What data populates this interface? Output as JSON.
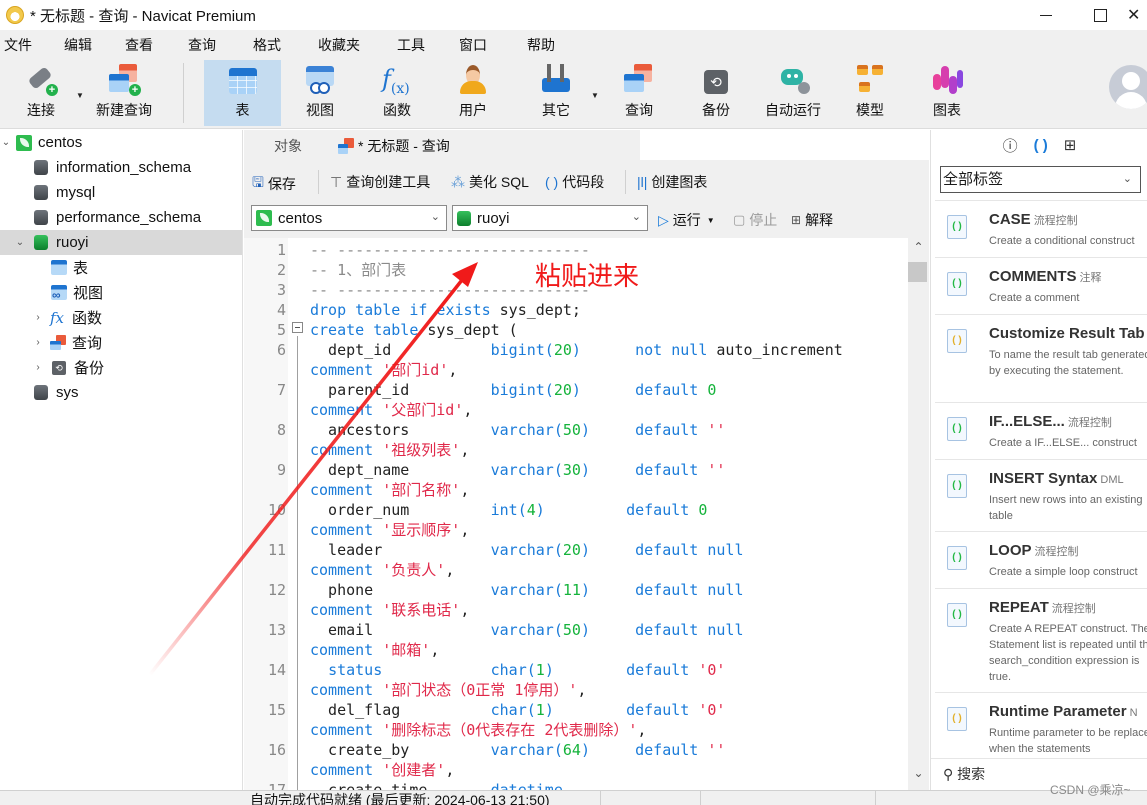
{
  "window": {
    "title": "* 无标题 - 查询 - Navicat Premium",
    "controls": {
      "minimize": "minimize",
      "maximize": "maximize",
      "close": "close"
    }
  },
  "menu": [
    "文件",
    "编辑",
    "查看",
    "查询",
    "格式",
    "收藏夹",
    "工具",
    "窗口",
    "帮助"
  ],
  "toolbar": {
    "connect": "连接",
    "new_query": "新建查询",
    "table": "表",
    "view": "视图",
    "function": "函数",
    "user": "用户",
    "other": "其它",
    "query": "查询",
    "backup": "备份",
    "automation": "自动运行",
    "model": "模型",
    "chart": "图表",
    "active": "表"
  },
  "nav_tree": {
    "connection": "centos",
    "databases": [
      "information_schema",
      "mysql",
      "performance_schema",
      "ruoyi",
      "sys"
    ],
    "selected_db": "ruoyi",
    "ruoyi_children": [
      "表",
      "视图",
      "函数",
      "查询",
      "备份"
    ]
  },
  "tabs": {
    "objects": "对象",
    "active": "* 无标题 - 查询"
  },
  "query_toolbar": {
    "save": "保存",
    "query_builder": "查询创建工具",
    "beautify": "美化 SQL",
    "snippet": "代码段",
    "create_chart": "创建图表"
  },
  "conn_bar": {
    "connection": "centos",
    "database": "ruoyi",
    "run": "运行",
    "stop": "停止",
    "explain": "解释"
  },
  "editor": {
    "lines": [
      {
        "n": "1",
        "parts": [
          [
            "cmt",
            "-- ----------------------------"
          ]
        ]
      },
      {
        "n": "2",
        "parts": [
          [
            "cmt",
            "-- 1、部门表"
          ]
        ]
      },
      {
        "n": "3",
        "parts": [
          [
            "cmt",
            "-- ----------------------------"
          ]
        ]
      },
      {
        "n": "4",
        "parts": [
          [
            "kw",
            "drop table if exists "
          ],
          [
            "",
            "sys_dept;"
          ]
        ]
      },
      {
        "n": "5",
        "parts": [
          [
            "kw",
            "create table "
          ],
          [
            "",
            "sys_dept ("
          ]
        ]
      },
      {
        "n": "6",
        "parts": [
          [
            "",
            "  dept_id           "
          ],
          [
            "kw",
            "bigint("
          ],
          [
            "num",
            "20"
          ],
          [
            "kw",
            ")"
          ],
          [
            "",
            "      "
          ],
          [
            "kw",
            "not null "
          ],
          [
            "",
            "auto_increment"
          ]
        ]
      },
      {
        "n": "",
        "parts": [
          [
            "kw",
            "comment "
          ],
          [
            "str",
            "'部门id'"
          ],
          [
            "",
            ","
          ]
        ]
      },
      {
        "n": "7",
        "parts": [
          [
            "",
            "  parent_id         "
          ],
          [
            "kw",
            "bigint("
          ],
          [
            "num",
            "20"
          ],
          [
            "kw",
            ")"
          ],
          [
            "",
            "      "
          ],
          [
            "kw",
            "default "
          ],
          [
            "num",
            "0"
          ]
        ]
      },
      {
        "n": "",
        "parts": [
          [
            "kw",
            "comment "
          ],
          [
            "str",
            "'父部门id'"
          ],
          [
            "",
            ","
          ]
        ]
      },
      {
        "n": "8",
        "parts": [
          [
            "",
            "  ancestors         "
          ],
          [
            "kw",
            "varchar("
          ],
          [
            "num",
            "50"
          ],
          [
            "kw",
            ")"
          ],
          [
            "",
            "     "
          ],
          [
            "kw",
            "default "
          ],
          [
            "str",
            "''"
          ]
        ]
      },
      {
        "n": "",
        "parts": [
          [
            "kw",
            "comment "
          ],
          [
            "str",
            "'祖级列表'"
          ],
          [
            "",
            ","
          ]
        ]
      },
      {
        "n": "9",
        "parts": [
          [
            "",
            "  dept_name         "
          ],
          [
            "kw",
            "varchar("
          ],
          [
            "num",
            "30"
          ],
          [
            "kw",
            ")"
          ],
          [
            "",
            "     "
          ],
          [
            "kw",
            "default "
          ],
          [
            "str",
            "''"
          ]
        ]
      },
      {
        "n": "",
        "parts": [
          [
            "kw",
            "comment "
          ],
          [
            "str",
            "'部门名称'"
          ],
          [
            "",
            ","
          ]
        ]
      },
      {
        "n": "10",
        "parts": [
          [
            "",
            "  order_num         "
          ],
          [
            "kw",
            "int("
          ],
          [
            "num",
            "4"
          ],
          [
            "kw",
            ")"
          ],
          [
            "",
            "         "
          ],
          [
            "kw",
            "default "
          ],
          [
            "num",
            "0"
          ]
        ]
      },
      {
        "n": "",
        "parts": [
          [
            "kw",
            "comment "
          ],
          [
            "str",
            "'显示顺序'"
          ],
          [
            "",
            ","
          ]
        ]
      },
      {
        "n": "11",
        "parts": [
          [
            "",
            "  leader            "
          ],
          [
            "kw",
            "varchar("
          ],
          [
            "num",
            "20"
          ],
          [
            "kw",
            ")"
          ],
          [
            "",
            "     "
          ],
          [
            "kw",
            "default null"
          ]
        ]
      },
      {
        "n": "",
        "parts": [
          [
            "kw",
            "comment "
          ],
          [
            "str",
            "'负责人'"
          ],
          [
            "",
            ","
          ]
        ]
      },
      {
        "n": "12",
        "parts": [
          [
            "",
            "  phone             "
          ],
          [
            "kw",
            "varchar("
          ],
          [
            "num",
            "11"
          ],
          [
            "kw",
            ")"
          ],
          [
            "",
            "     "
          ],
          [
            "kw",
            "default null"
          ]
        ]
      },
      {
        "n": "",
        "parts": [
          [
            "kw",
            "comment "
          ],
          [
            "str",
            "'联系电话'"
          ],
          [
            "",
            ","
          ]
        ]
      },
      {
        "n": "13",
        "parts": [
          [
            "",
            "  email             "
          ],
          [
            "kw",
            "varchar("
          ],
          [
            "num",
            "50"
          ],
          [
            "kw",
            ")"
          ],
          [
            "",
            "     "
          ],
          [
            "kw",
            "default null"
          ]
        ]
      },
      {
        "n": "",
        "parts": [
          [
            "kw",
            "comment "
          ],
          [
            "str",
            "'邮箱'"
          ],
          [
            "",
            ","
          ]
        ]
      },
      {
        "n": "14",
        "parts": [
          [
            "",
            "  "
          ],
          [
            "kw",
            "status"
          ],
          [
            "",
            "            "
          ],
          [
            "kw",
            "char("
          ],
          [
            "num",
            "1"
          ],
          [
            "kw",
            ")"
          ],
          [
            "",
            "        "
          ],
          [
            "kw",
            "default "
          ],
          [
            "str",
            "'0'"
          ]
        ]
      },
      {
        "n": "",
        "parts": [
          [
            "kw",
            "comment "
          ],
          [
            "str",
            "'部门状态（0正常 1停用）'"
          ],
          [
            "",
            ","
          ]
        ]
      },
      {
        "n": "15",
        "parts": [
          [
            "",
            "  del_flag          "
          ],
          [
            "kw",
            "char("
          ],
          [
            "num",
            "1"
          ],
          [
            "kw",
            ")"
          ],
          [
            "",
            "        "
          ],
          [
            "kw",
            "default "
          ],
          [
            "str",
            "'0'"
          ]
        ]
      },
      {
        "n": "",
        "parts": [
          [
            "kw",
            "comment "
          ],
          [
            "str",
            "'删除标志（0代表存在 2代表删除）'"
          ],
          [
            "",
            ","
          ]
        ]
      },
      {
        "n": "16",
        "parts": [
          [
            "",
            "  create_by         "
          ],
          [
            "kw",
            "varchar("
          ],
          [
            "num",
            "64"
          ],
          [
            "kw",
            ")"
          ],
          [
            "",
            "     "
          ],
          [
            "kw",
            "default "
          ],
          [
            "str",
            "''"
          ]
        ]
      },
      {
        "n": "",
        "parts": [
          [
            "kw",
            "comment "
          ],
          [
            "str",
            "'创建者'"
          ],
          [
            "",
            ","
          ]
        ]
      },
      {
        "n": "17",
        "parts": [
          [
            "",
            "  create_time       "
          ],
          [
            "kw",
            "datetime"
          ]
        ]
      }
    ]
  },
  "annotation": {
    "text": "粘贴进来",
    "color": "#f01a1a"
  },
  "snippets_panel": {
    "tag_filter": "全部标签",
    "items": [
      {
        "title": "CASE",
        "tag": "流程控制",
        "desc": "Create a conditional construct",
        "icon": "green"
      },
      {
        "title": "COMMENTS",
        "tag": "注释",
        "desc": "Create a comment",
        "icon": "green"
      },
      {
        "title": "Customize Result Tab",
        "tag": "",
        "desc": "To name the result tab generated by executing the statement.",
        "icon": "yellow"
      },
      {
        "title": "IF...ELSE...",
        "tag": "流程控制",
        "desc": "Create a IF...ELSE... construct",
        "icon": "green"
      },
      {
        "title": "INSERT Syntax",
        "tag": "DML",
        "desc": "Insert new rows into an existing table",
        "icon": "green"
      },
      {
        "title": "LOOP",
        "tag": "流程控制",
        "desc": "Create a simple loop construct",
        "icon": "green"
      },
      {
        "title": "REPEAT",
        "tag": "流程控制",
        "desc": "Create A REPEAT construct. The Statement list is repeated until the search_condition expression is true.",
        "icon": "green"
      },
      {
        "title": "Runtime Parameter",
        "tag": "N",
        "desc": "Runtime parameter to be replaced when the statements",
        "icon": "yellow"
      }
    ],
    "search_placeholder": "搜索"
  },
  "statusbar": {
    "text": "自动完成代码就绪 (最后更新: 2024-06-13 21:50)"
  },
  "watermark": "CSDN @乘凉~"
}
